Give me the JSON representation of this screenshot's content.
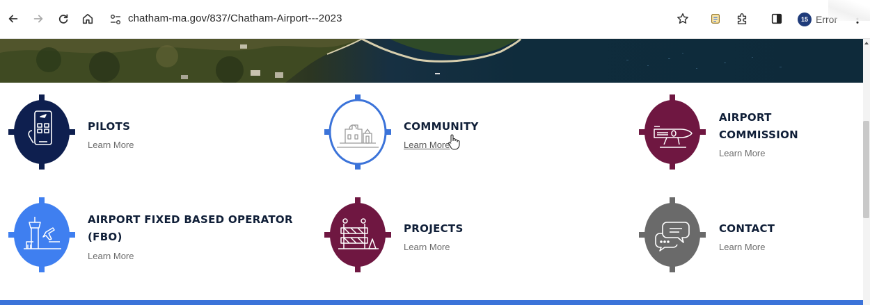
{
  "browser": {
    "url": "chatham-ma.gov/837/Chatham-Airport---2023",
    "profile_status": "Error",
    "profile_initials": "15"
  },
  "tiles": [
    {
      "title": "PILOTS",
      "link": "Learn More",
      "color": "#0e1f4f",
      "icon": "smartphone-airplane-icon"
    },
    {
      "title": "COMMUNITY",
      "link": "Learn More",
      "color": "#ffffff",
      "ring": "#3b73d9",
      "icon": "buildings-icon"
    },
    {
      "title_line1": "AIRPORT",
      "title_line2": "COMMISSION",
      "link": "Learn More",
      "color": "#6f1741",
      "icon": "airplane-icon"
    },
    {
      "title_line1": "AIRPORT FIXED BASED OPERATOR",
      "title_line2": "(FBO)",
      "link": "Learn More",
      "color": "#3f7ff0",
      "icon": "control-tower-icon"
    },
    {
      "title": "PROJECTS",
      "link": "Learn More",
      "color": "#6f1741",
      "icon": "construction-barrier-icon"
    },
    {
      "title": "CONTACT",
      "link": "Learn More",
      "color": "#6a6a6a",
      "icon": "chat-bubbles-icon"
    }
  ],
  "colors": {
    "navy": "#0e1f4f",
    "blue": "#3b73d9",
    "maroon": "#6f1741",
    "gray": "#6a6a6a",
    "title_text": "#0f1e37"
  }
}
